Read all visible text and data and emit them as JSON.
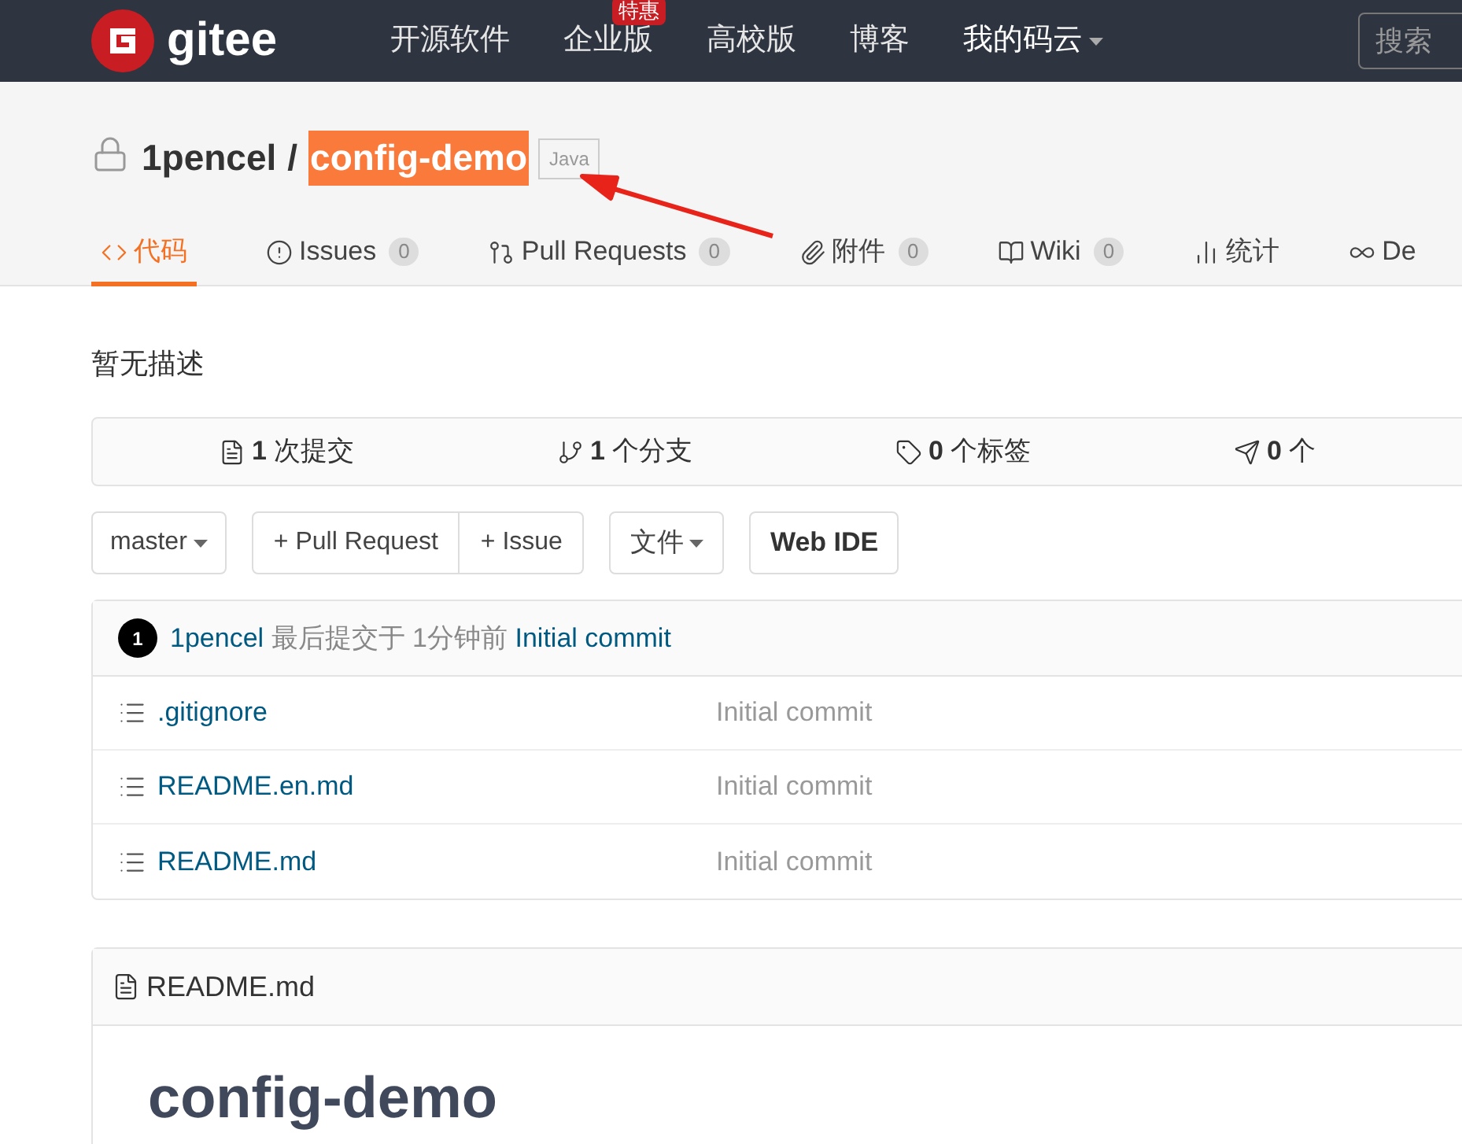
{
  "navbar": {
    "logo_text": "gitee",
    "items": [
      {
        "label": "开源软件",
        "dropdown": false
      },
      {
        "label": "企业版",
        "badge": "特惠",
        "dropdown": false
      },
      {
        "label": "高校版",
        "dropdown": false
      },
      {
        "label": "博客",
        "dropdown": false
      },
      {
        "label": "我的码云",
        "dropdown": true
      }
    ],
    "search": {
      "placeholder": "搜索"
    }
  },
  "repo": {
    "owner": "1pencel",
    "separator": "/",
    "name": "config-demo",
    "name_highlighted": true,
    "language": "Java"
  },
  "tabs": [
    {
      "kind": "code",
      "label": "代码",
      "selected": true
    },
    {
      "kind": "issues",
      "label": "Issues",
      "count": "0",
      "selected": false
    },
    {
      "kind": "pull",
      "label": "Pull Requests",
      "count": "0",
      "selected": false
    },
    {
      "kind": "attach",
      "label": "附件",
      "count": "0",
      "selected": false
    },
    {
      "kind": "wiki",
      "label": "Wiki",
      "count": "0",
      "selected": false
    },
    {
      "kind": "stats",
      "label": "统计",
      "selected": false
    },
    {
      "kind": "devops",
      "label": "De",
      "selected": false
    }
  ],
  "description": "暂无描述",
  "stats": [
    {
      "kind": "commits",
      "number": "1",
      "label": "次提交"
    },
    {
      "kind": "branches",
      "number": "1",
      "label": "个分支"
    },
    {
      "kind": "tags",
      "number": "0",
      "label": "个标签"
    },
    {
      "kind": "releases",
      "number": "0",
      "label": "个"
    }
  ],
  "actions": {
    "branch": "master",
    "pull_request": "+ Pull Request",
    "issue": "+ Issue",
    "files": "文件",
    "web_ide": "Web IDE"
  },
  "last_commit": {
    "avatar": "1",
    "author": "1pencel",
    "text": "最后提交于",
    "time": "1分钟前",
    "message": "Initial commit"
  },
  "files": [
    {
      "name": ".gitignore",
      "message": "Initial commit"
    },
    {
      "name": "README.en.md",
      "message": "Initial commit"
    },
    {
      "name": "README.md",
      "message": "Initial commit"
    }
  ],
  "readme": {
    "filename": "README.md",
    "heading": "config-demo"
  }
}
